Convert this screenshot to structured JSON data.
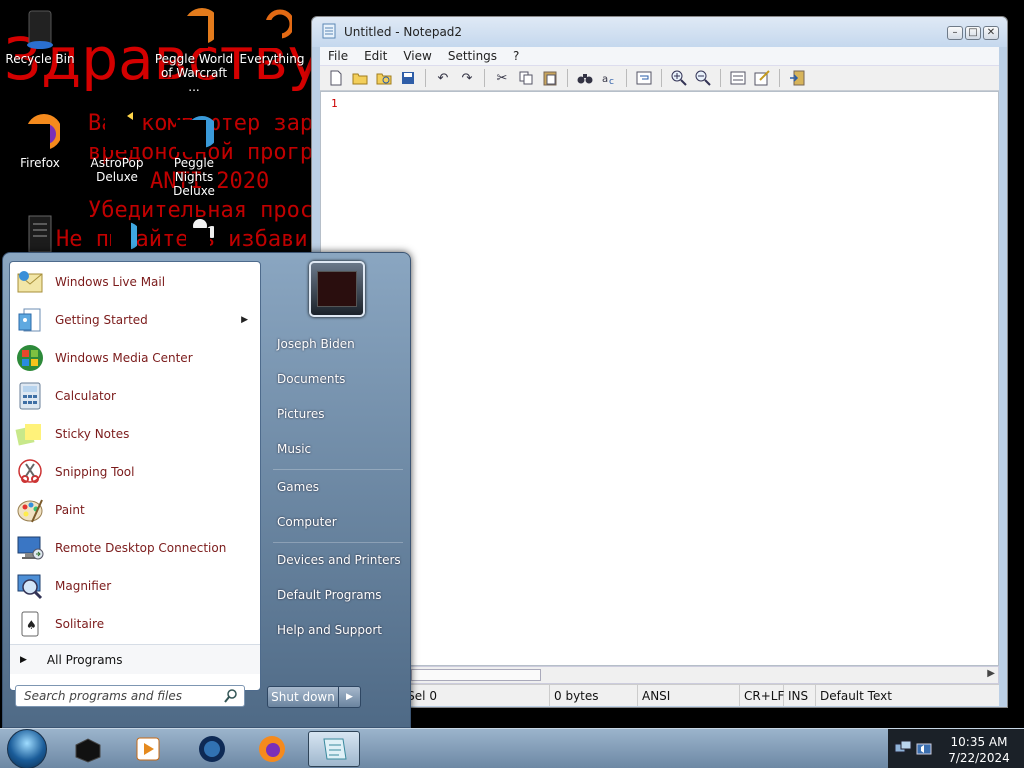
{
  "wallpaper": {
    "big_text": "Здравствуй",
    "lines": [
      "Ваш компьютер зар",
      "вредоносной програ",
      "ANTI 2020",
      "Убедительная прос",
      "Не пытайтесь избави"
    ]
  },
  "desktop_icons": [
    {
      "label1": "Recycle Bin",
      "label2": ""
    },
    {
      "label1": "Peggle World",
      "label2": "of Warcraft ..."
    },
    {
      "label1": "Everything",
      "label2": ""
    },
    {
      "label1": "Firefox",
      "label2": ""
    },
    {
      "label1": "AstroPop",
      "label2": "Deluxe"
    },
    {
      "label1": "Peggle Nights",
      "label2": "Deluxe"
    }
  ],
  "notepad": {
    "title": "Untitled - Notepad2",
    "menu": [
      "File",
      "Edit",
      "View",
      "Settings",
      "?"
    ],
    "line_number": "1",
    "status": {
      "position": "Ln 1 : 1   Col 1   Sel 0",
      "size": "0 bytes",
      "encoding": "ANSI",
      "line_ending": "CR+LF",
      "insert_mode": "INS",
      "scheme": "Default Text"
    }
  },
  "start_menu": {
    "programs": [
      {
        "label": "Windows Live Mail",
        "icon": "mail-icon"
      },
      {
        "label": "Getting Started",
        "icon": "getting-started-icon",
        "submenu": "▶"
      },
      {
        "label": "Windows Media Center",
        "icon": "media-center-icon"
      },
      {
        "label": "Calculator",
        "icon": "calculator-icon"
      },
      {
        "label": "Sticky Notes",
        "icon": "sticky-notes-icon"
      },
      {
        "label": "Snipping Tool",
        "icon": "scissors-icon"
      },
      {
        "label": "Paint",
        "icon": "paint-palette-icon"
      },
      {
        "label": "Remote Desktop Connection",
        "icon": "remote-desktop-icon"
      },
      {
        "label": "Magnifier",
        "icon": "magnifier-icon"
      },
      {
        "label": "Solitaire",
        "icon": "playing-card-icon"
      }
    ],
    "all_programs": "All Programs",
    "search_placeholder": "Search programs and files",
    "right_links": [
      "Joseph Biden",
      "Documents",
      "Pictures",
      "Music",
      "Games",
      "Computer",
      "Devices and Printers",
      "Default Programs",
      "Help and Support"
    ],
    "shutdown": "Shut down"
  },
  "taskbar": {
    "time": "10:35 AM",
    "date": "7/22/2024"
  },
  "colors": {
    "program_label": "#7b1b1b",
    "wallpaper_text": "#d40000",
    "taskbar": "#8aa3bd"
  }
}
